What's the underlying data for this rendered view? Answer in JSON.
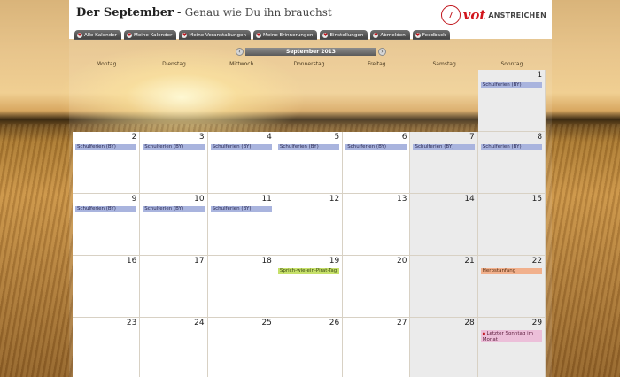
{
  "header": {
    "title_bold": "Der September",
    "title_sep": " - ",
    "subtitle": "Genau wie Du ihn brauchst",
    "logo_badge": "7",
    "logo_word": "vot",
    "logo_suffix": "ANSTREICHEN"
  },
  "tabs": [
    {
      "label": "Alle Kalender"
    },
    {
      "label": "Meine Kalender"
    },
    {
      "label": "Meine Veranstaltungen"
    },
    {
      "label": "Meine Erinnerungen"
    },
    {
      "label": "Einstellungen"
    },
    {
      "label": "Abmelden"
    },
    {
      "label": "Feedback"
    }
  ],
  "calendar": {
    "month_label": "September 2013",
    "weekdays": [
      "Montag",
      "Dienstag",
      "Mittwoch",
      "Donnerstag",
      "Freitag",
      "Samstag",
      "Sonntag"
    ],
    "days": [
      {
        "num": "",
        "empty": true
      },
      {
        "num": "",
        "empty": true
      },
      {
        "num": "",
        "empty": true
      },
      {
        "num": "",
        "empty": true
      },
      {
        "num": "",
        "empty": true
      },
      {
        "num": "",
        "empty": true
      },
      {
        "num": "1",
        "weekend": true,
        "event": "Schulferien (BY)",
        "type": "holiday"
      },
      {
        "num": "2",
        "event": "Schulferien (BY)",
        "type": "holiday"
      },
      {
        "num": "3",
        "event": "Schulferien (BY)",
        "type": "holiday"
      },
      {
        "num": "4",
        "event": "Schulferien (BY)",
        "type": "holiday"
      },
      {
        "num": "5",
        "event": "Schulferien (BY)",
        "type": "holiday"
      },
      {
        "num": "6",
        "event": "Schulferien (BY)",
        "type": "holiday"
      },
      {
        "num": "7",
        "weekend": true,
        "event": "Schulferien (BY)",
        "type": "holiday"
      },
      {
        "num": "8",
        "weekend": true,
        "event": "Schulferien (BY)",
        "type": "holiday"
      },
      {
        "num": "9",
        "event": "Schulferien (BY)",
        "type": "holiday"
      },
      {
        "num": "10",
        "event": "Schulferien (BY)",
        "type": "holiday"
      },
      {
        "num": "11",
        "event": "Schulferien (BY)",
        "type": "holiday"
      },
      {
        "num": "12"
      },
      {
        "num": "13"
      },
      {
        "num": "14",
        "weekend": true
      },
      {
        "num": "15",
        "weekend": true
      },
      {
        "num": "16"
      },
      {
        "num": "17"
      },
      {
        "num": "18"
      },
      {
        "num": "19",
        "event": "Sprich-wie-ein-Pirat-Tag",
        "type": "fun"
      },
      {
        "num": "20"
      },
      {
        "num": "21",
        "weekend": true
      },
      {
        "num": "22",
        "weekend": true,
        "event": "Herbstanfang",
        "type": "season"
      },
      {
        "num": "23"
      },
      {
        "num": "24"
      },
      {
        "num": "25"
      },
      {
        "num": "26"
      },
      {
        "num": "27"
      },
      {
        "num": "28",
        "weekend": true
      },
      {
        "num": "29",
        "weekend": true,
        "event": "Letzter Sonntag im Monat",
        "type": "special"
      }
    ]
  },
  "colors": {
    "holiday": "#a9b4de",
    "fun": "#c6e06a",
    "season": "#f1b08c",
    "special": "#ecbfd9",
    "brand": "#d1141b"
  }
}
